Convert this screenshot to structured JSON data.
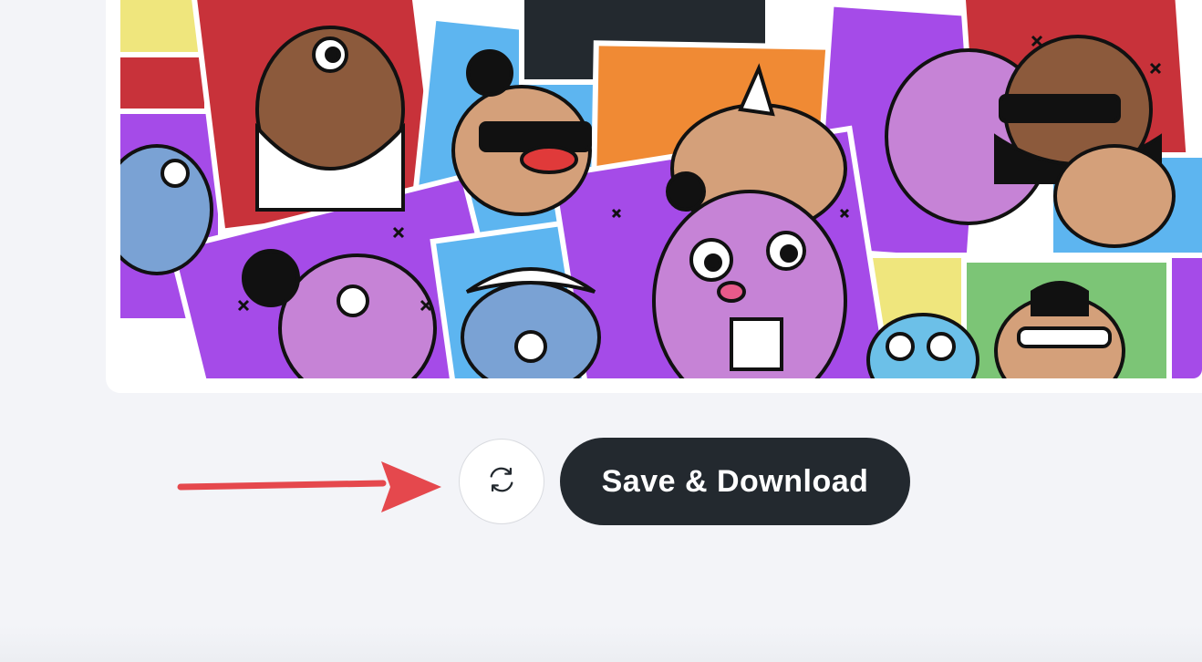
{
  "actions": {
    "refresh_icon": "refresh-icon",
    "save_label": "Save & Download"
  },
  "annotation": {
    "arrow_color": "#e5484d"
  },
  "collage": {
    "description_colors": [
      "#efe67d",
      "#c8323a",
      "#5db5f0",
      "#f08a34",
      "#a54be8",
      "#7cc576",
      "#c683d6"
    ]
  }
}
